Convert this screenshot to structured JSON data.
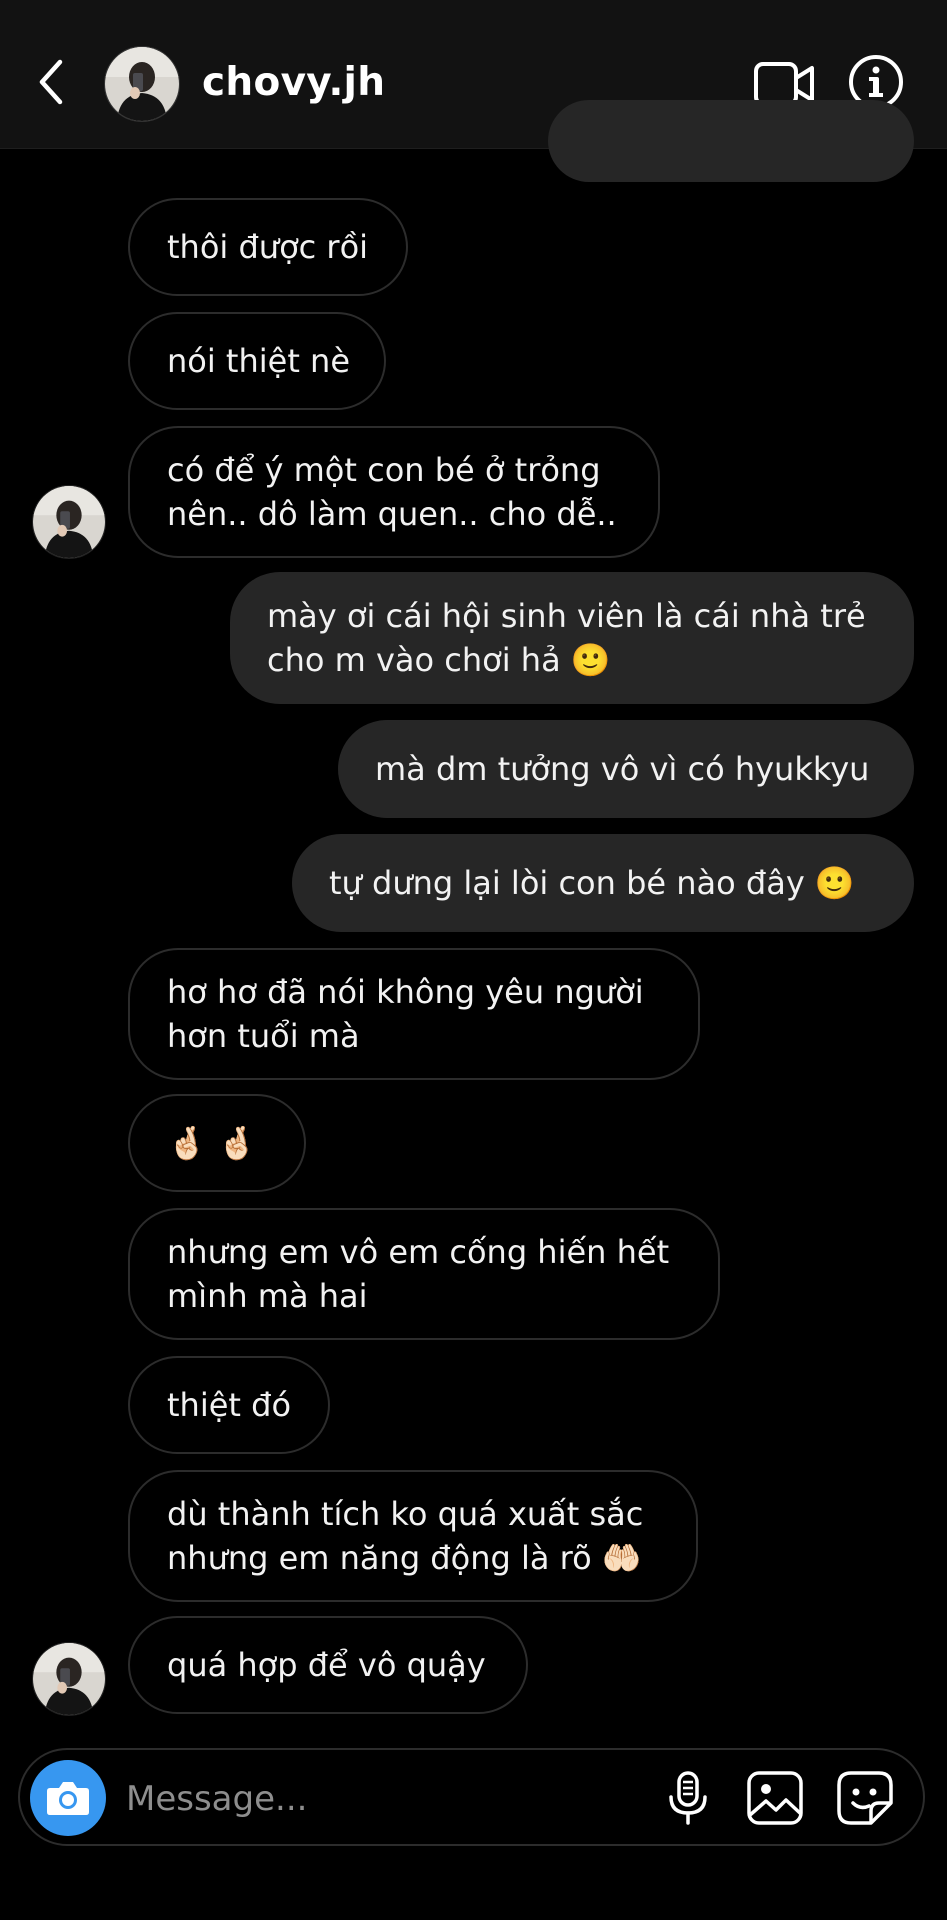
{
  "header": {
    "username": "chovy.jh",
    "back_icon": "chevron-left-icon",
    "video_icon": "video-camera-icon",
    "info_icon": "info-icon"
  },
  "messages": [
    {
      "side": "out",
      "text": ""
    },
    {
      "side": "in",
      "text": "thôi được rồi"
    },
    {
      "side": "in",
      "text": "nói thiệt nè"
    },
    {
      "side": "in",
      "lines": [
        "có để ý một con bé ở trỏng",
        "nên.. dô làm quen.. cho dễ.."
      ]
    },
    {
      "side": "out",
      "lines": [
        "mày ơi cái hội sinh viên là cái nhà trẻ",
        "cho m vào chơi hả 🙂"
      ]
    },
    {
      "side": "out",
      "text": "mà dm tưởng vô vì có hyukkyu"
    },
    {
      "side": "out",
      "text": "tự dưng lại lòi con bé nào đây 🙂"
    },
    {
      "side": "in",
      "lines": [
        "hơ hơ đã nói không yêu người",
        "hơn tuổi mà"
      ]
    },
    {
      "side": "in",
      "text": "🤞🏻 🤞🏻"
    },
    {
      "side": "in",
      "lines": [
        "nhưng em vô em cống hiến hết",
        "mình mà hai"
      ]
    },
    {
      "side": "in",
      "text": "thiệt đó"
    },
    {
      "side": "in",
      "lines": [
        "dù thành tích ko quá xuất sắc",
        "nhưng em năng động là rõ 🤲🏻"
      ]
    },
    {
      "side": "in",
      "text": "quá hợp để vô quậy"
    }
  ],
  "composer": {
    "placeholder": "Message...",
    "camera_icon": "camera-icon",
    "mic_icon": "microphone-icon",
    "gallery_icon": "image-icon",
    "sticker_icon": "sticker-icon"
  },
  "colors": {
    "background": "#000000",
    "header_bg": "#121212",
    "outgoing_bubble": "#262626",
    "incoming_border": "#2c2c2c",
    "camera_button": "#3797f0",
    "placeholder": "#8e8e8e"
  }
}
